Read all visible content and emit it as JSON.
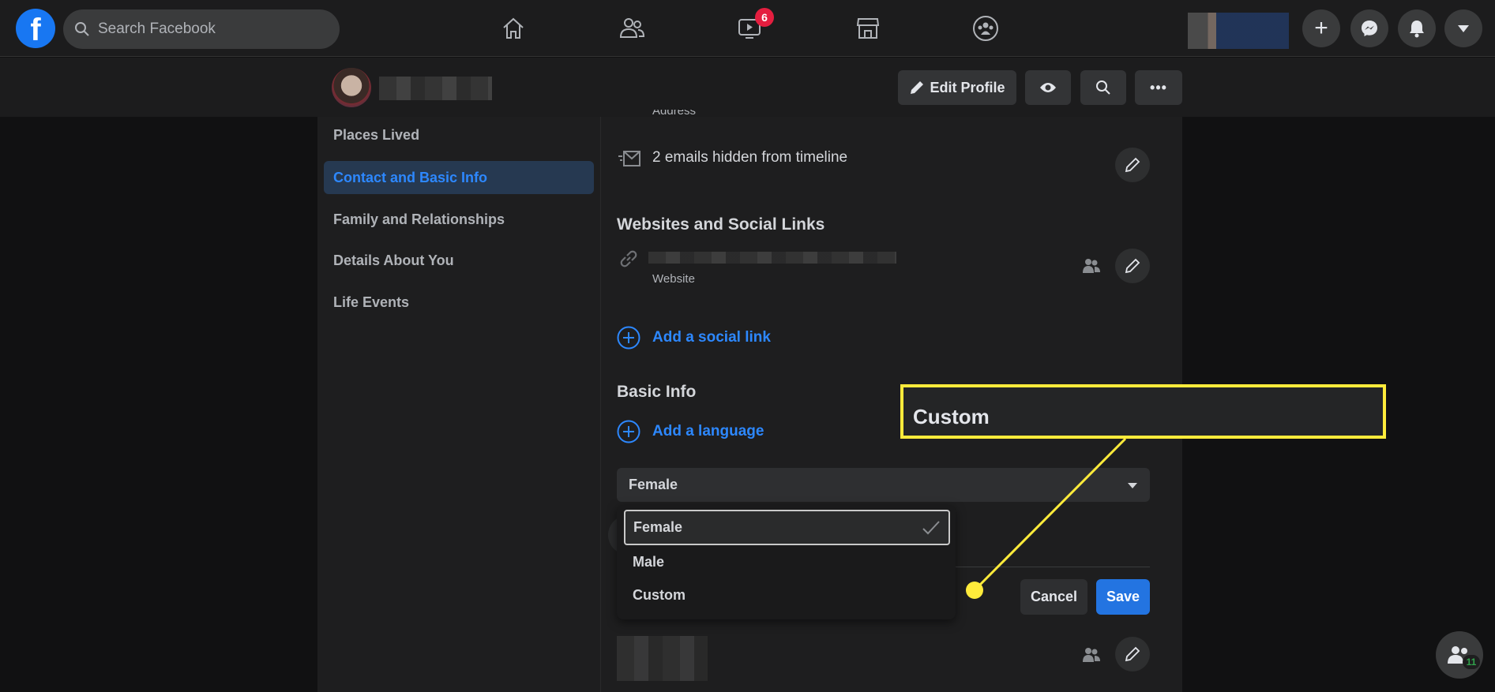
{
  "topbar": {
    "search_placeholder": "Search Facebook",
    "watch_badge": "6",
    "nav": [
      "home-icon",
      "friends-icon",
      "watch-icon",
      "marketplace-icon",
      "groups-icon"
    ]
  },
  "profile": {
    "edit_profile": "Edit Profile"
  },
  "sidebar": {
    "items": [
      {
        "label": "Places Lived"
      },
      {
        "label": "Contact and Basic Info",
        "selected": true
      },
      {
        "label": "Family and Relationships"
      },
      {
        "label": "Details About You"
      },
      {
        "label": "Life Events"
      }
    ]
  },
  "contact": {
    "address_label": "Address",
    "emails": "2 emails hidden from timeline"
  },
  "websites": {
    "title": "Websites and Social Links",
    "website_label": "Website",
    "add_social": "Add a social link"
  },
  "basic": {
    "title": "Basic Info",
    "add_language": "Add a language",
    "gender_value": "Female",
    "options": [
      "Female",
      "Male",
      "Custom"
    ],
    "cancel": "Cancel",
    "save": "Save"
  },
  "callout": {
    "text": "Custom",
    "color": "#ffeb3b"
  },
  "contacts_badge": "11",
  "colors": {
    "accent": "#2d88ff",
    "save": "#2374e1",
    "badge": "#e41e3f"
  }
}
